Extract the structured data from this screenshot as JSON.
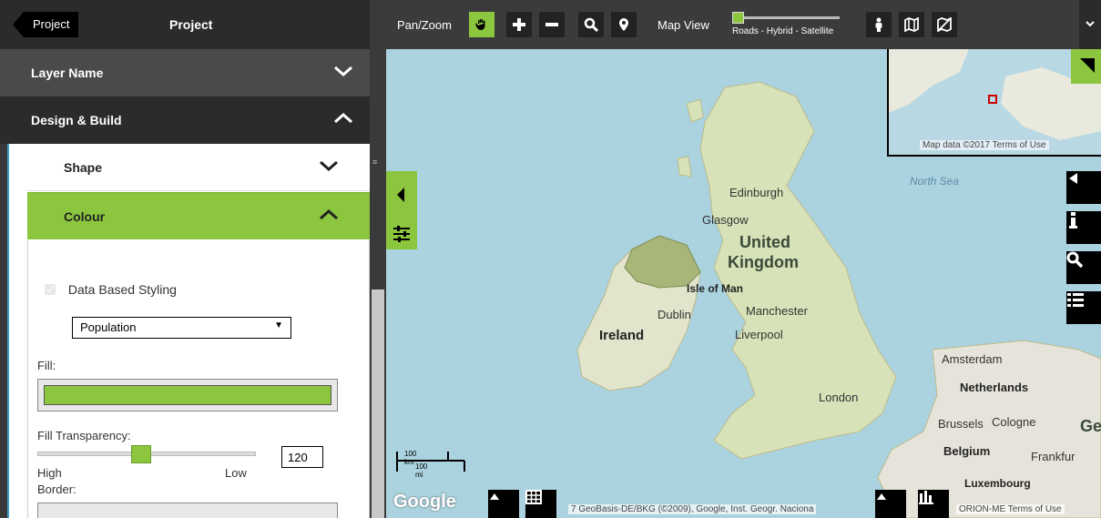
{
  "sidebar": {
    "back_label": "Project",
    "title": "Project",
    "accordion_layer": "Layer Name",
    "accordion_design": "Design & Build",
    "sub_shape": "Shape",
    "sub_colour": "Colour",
    "data_based_styling": "Data Based Styling",
    "data_field_selected": "Population",
    "fill_label": "Fill:",
    "fill_color": "#8cc63f",
    "fill_transparency_label": "Fill Transparency:",
    "fill_transparency_value": "120",
    "slider_high": "High",
    "slider_low": "Low",
    "border_label": "Border:"
  },
  "toolbar": {
    "pan_zoom_label": "Pan/Zoom",
    "map_view_label": "Map View",
    "map_view_options": "Roads - Hybrid - Satellite",
    "accent": "#8cc63f"
  },
  "map": {
    "places": {
      "edinburgh": "Edinburgh",
      "glasgow": "Glasgow",
      "united": "United",
      "kingdom": "Kingdom",
      "isle_of_man": "Isle of Man",
      "dublin": "Dublin",
      "ireland": "Ireland",
      "manchester": "Manchester",
      "liverpool": "Liverpool",
      "london": "London",
      "north_sea": "North Sea",
      "amsterdam": "Amsterdam",
      "netherlands": "Netherlands",
      "brussels": "Brussels",
      "cologne": "Cologne",
      "belgium": "Belgium",
      "frankfurt": "Frankfur",
      "luxembourg": "Luxembourg",
      "ge": "Ge"
    },
    "overview_credit": "Map data ©2017   Terms of Use",
    "scale_km": "100 km",
    "scale_mi": "100 mi",
    "google": "Google",
    "credits_left": "7 GeoBasis-DE/BKG (©2009), Google, Inst. Geogr. Naciona",
    "credits_right": "ORION-ME   Terms of Use"
  }
}
